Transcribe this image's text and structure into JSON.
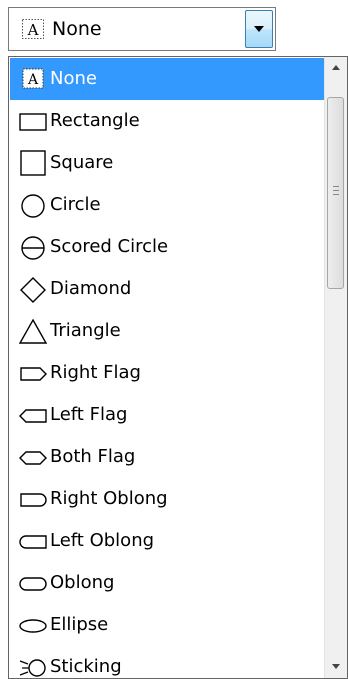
{
  "combo": {
    "selected_label": "None",
    "selected_icon": "letter-a-icon"
  },
  "dropdown": {
    "items": [
      {
        "label": "None",
        "icon": "letter-a-icon",
        "selected": true
      },
      {
        "label": "Rectangle",
        "icon": "rectangle-icon"
      },
      {
        "label": "Square",
        "icon": "square-icon"
      },
      {
        "label": "Circle",
        "icon": "circle-icon"
      },
      {
        "label": "Scored Circle",
        "icon": "scored-circle-icon"
      },
      {
        "label": "Diamond",
        "icon": "diamond-icon"
      },
      {
        "label": "Triangle",
        "icon": "triangle-icon"
      },
      {
        "label": "Right Flag",
        "icon": "right-flag-icon"
      },
      {
        "label": "Left Flag",
        "icon": "left-flag-icon"
      },
      {
        "label": "Both Flag",
        "icon": "both-flag-icon"
      },
      {
        "label": "Right Oblong",
        "icon": "right-oblong-icon"
      },
      {
        "label": "Left Oblong",
        "icon": "left-oblong-icon"
      },
      {
        "label": "Oblong",
        "icon": "oblong-icon"
      },
      {
        "label": "Ellipse",
        "icon": "ellipse-icon"
      },
      {
        "label": "Sticking",
        "icon": "sticking-icon"
      }
    ],
    "selection_color": "#3399ff"
  }
}
